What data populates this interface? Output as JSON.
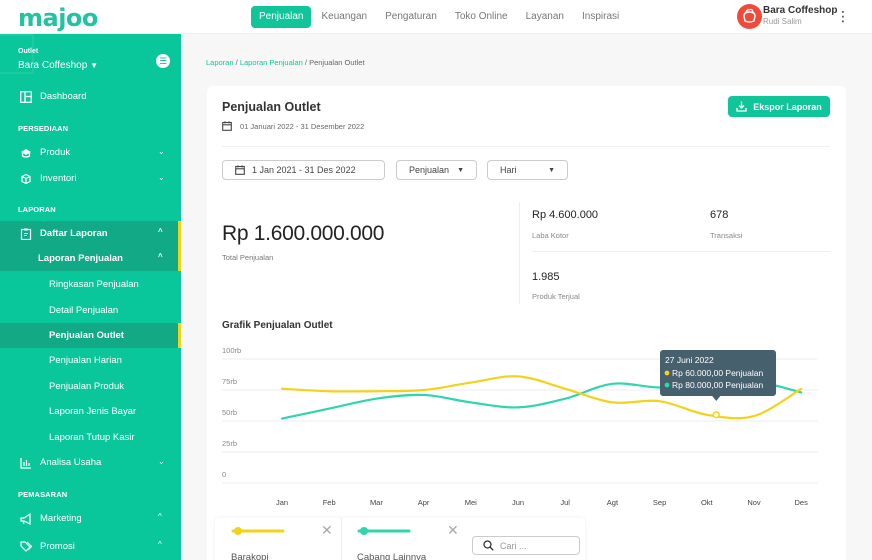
{
  "app": {
    "logo": "majoo"
  },
  "topnav": {
    "items": [
      {
        "label": "Penjualan",
        "active": true
      },
      {
        "label": "Keuangan",
        "active": false
      },
      {
        "label": "Pengaturan",
        "active": false
      },
      {
        "label": "Toko Online",
        "active": false
      },
      {
        "label": "Layanan",
        "active": false
      },
      {
        "label": "Inspirasi",
        "active": false
      }
    ],
    "icons": {
      "notification": "bell-icon",
      "menu": "kebab-icon"
    }
  },
  "user": {
    "store": "Bara Coffeshop",
    "name": "Rudi Salim"
  },
  "sidebar": {
    "outlet_label": "Outlet",
    "outlet_value": "Bara Coffeshop",
    "dashboard": "Dashboard",
    "section_persediaan": "PERSEDIAAN",
    "produk": "Produk",
    "inventori": "Inventori",
    "section_laporan": "LAPORAN",
    "daftar_laporan": "Daftar Laporan",
    "laporan_penjualan": "Laporan Penjualan",
    "sub_items": [
      "Ringkasan Penjualan",
      "Detail Penjualan",
      "Penjualan Outlet",
      "Penjualan Harian",
      "Penjualan Produk",
      "Laporan Jenis Bayar",
      "Laporan Tutup Kasir"
    ],
    "active_sub": "Penjualan Outlet",
    "analisa_usaha": "Analisa Usaha",
    "section_pemasaran": "PEMASARAN",
    "marketing": "Marketing",
    "promosi": "Promosi"
  },
  "breadcrumb": {
    "items": [
      "Laporan",
      "Laporan Penjualan",
      "Penjualan Outlet"
    ],
    "sep": "/"
  },
  "page": {
    "title": "Penjualan Outlet",
    "period": "01 Januari 2022 - 31 Desember  2022",
    "export_label": "Ekspor Laporan",
    "filters": {
      "date_range": "1 Jan 2021 - 31 Des 2022",
      "metric": "Penjualan",
      "granularity": "Hari"
    }
  },
  "summary": {
    "total_value": "Rp 1.600.000.000",
    "total_label": "Total Penjualan",
    "laba_value": "Rp 4.600.000",
    "laba_label": "Laba Kotor",
    "transaksi_value": "678",
    "transaksi_label": "Transaksi",
    "produk_value": "1.985",
    "produk_label": "Produk Terjual"
  },
  "chart_data": {
    "type": "line",
    "title": "Grafik Penjualan Outlet",
    "categories": [
      "Jan",
      "Feb",
      "Mar",
      "Apr",
      "Mei",
      "Jun",
      "Jul",
      "Agt",
      "Sep",
      "Okt",
      "Nov",
      "Des"
    ],
    "y_ticks": [
      "0",
      "25rb",
      "50rb",
      "75rb",
      "100rb"
    ],
    "ylim": [
      0,
      100
    ],
    "y_unit": "rb",
    "grid": true,
    "series": [
      {
        "name": "Barakopi",
        "color": "#f2d31b",
        "values": [
          76,
          74,
          74,
          75,
          81,
          86,
          76,
          65,
          66,
          55,
          54,
          76
        ]
      },
      {
        "name": "Cabang Lainnya",
        "color": "#2fd5ad",
        "values": [
          52,
          60,
          68,
          71,
          65,
          61,
          68,
          80,
          77,
          80,
          82,
          73
        ]
      }
    ],
    "tooltip": {
      "title": "27 Juni 2022",
      "lines": [
        {
          "color": "#f2d31b",
          "text": "Rp 60.000,00 Penjualan"
        },
        {
          "color": "#2fd5ad",
          "text": "Rp 80.000,00 Penjualan"
        }
      ],
      "anchor_series": 0,
      "anchor_x": 9.2,
      "anchor_value": 55
    }
  },
  "legend": {
    "items": [
      {
        "name": "Barakopi",
        "color": "#f2d31b"
      },
      {
        "name": "Cabang Lainnya",
        "color": "#2fd5ad"
      }
    ],
    "search_placeholder": "Cari ..."
  }
}
